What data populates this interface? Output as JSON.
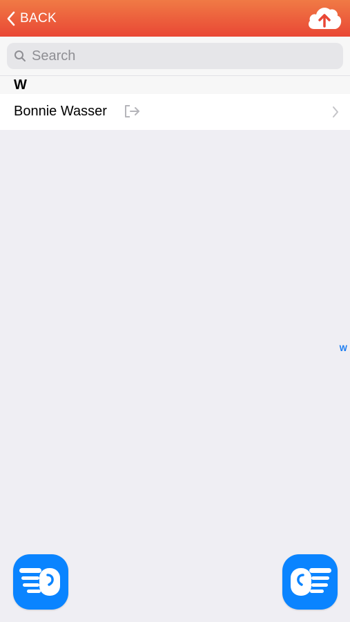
{
  "nav": {
    "back_label": "BACK",
    "back_icon": "chevron-left-icon",
    "upload_icon": "cloud-upload-icon",
    "gradient_top": "#f07a45",
    "gradient_bottom": "#e94735"
  },
  "search": {
    "placeholder": "Search",
    "icon": "search-icon"
  },
  "sections": [
    {
      "letter": "W",
      "contacts": [
        {
          "name": "Bonnie Wasser",
          "status_icon": "sign-out-icon"
        }
      ]
    }
  ],
  "index": [
    "W"
  ],
  "footer": {
    "left_icon": "hand-pointing-left-icon",
    "right_icon": "hand-pointing-right-icon",
    "accent": "#0a84ff"
  }
}
